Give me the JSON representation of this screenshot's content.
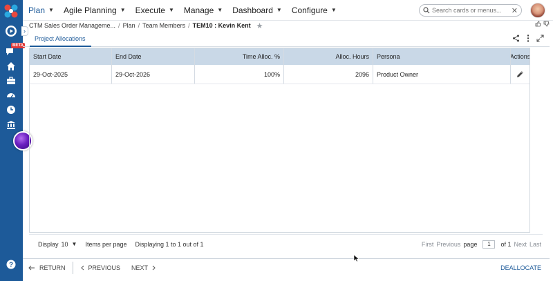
{
  "nav": {
    "items": [
      {
        "label": "Plan"
      },
      {
        "label": "Agile Planning"
      },
      {
        "label": "Execute"
      },
      {
        "label": "Manage"
      },
      {
        "label": "Dashboard"
      },
      {
        "label": "Configure"
      }
    ],
    "search_placeholder": "Search cards or menus...",
    "search_clear": "✕"
  },
  "rail": {
    "beta_label": "BETA",
    "collapse_glyph": "›",
    "icons": [
      "play-icon",
      "chat-icon",
      "home-icon",
      "briefcase-icon",
      "dashboard-icon",
      "clock-icon",
      "bank-icon",
      "help-icon"
    ]
  },
  "breadcrumb": {
    "items": [
      "CTM Sales Order Manageme...",
      "Plan",
      "Team Members"
    ],
    "current": "TEM10 : Kevin Kent"
  },
  "tab": {
    "label": "Project Allocations"
  },
  "table": {
    "columns": [
      "Start Date",
      "End Date",
      "Time Alloc. %",
      "Alloc. Hours",
      "Persona",
      "Actions"
    ],
    "rows": [
      {
        "start": "29-Oct-2025",
        "end": "29-Oct-2026",
        "time_alloc": "100%",
        "hours": "2096",
        "persona": "Product Owner"
      }
    ]
  },
  "pager": {
    "display_label": "Display",
    "per_page_value": "10",
    "items_per_page": "Items per page",
    "summary": "Displaying 1 to 1 out of 1",
    "first": "First",
    "previous": "Previous",
    "page_label": "page",
    "page_value": "1",
    "of_label": "of 1",
    "next": "Next",
    "last": "Last"
  },
  "footer": {
    "return": "RETURN",
    "previous": "PREVIOUS",
    "next": "NEXT",
    "deallocate": "DEALLOCATE"
  },
  "colors": {
    "brand": "#1d5a99",
    "header_fill": "#c9d8e7"
  }
}
